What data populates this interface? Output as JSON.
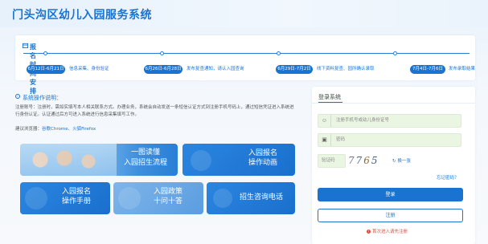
{
  "header": {
    "title": "门头沟区幼儿入园服务系统"
  },
  "schedule": {
    "title": "报名时间安排",
    "phases": [
      {
        "dates": "6月12日-6月21日",
        "desc": "信息采集、身份验证"
      },
      {
        "dates": "6月26日-6月28日",
        "desc": "发布复查通知，请认入园查询"
      },
      {
        "dates": "6月29日-7月2日",
        "desc": "线下资料复查、园所确认录取"
      },
      {
        "dates": "7月4日-7月6日",
        "desc": "发布录取结果"
      }
    ]
  },
  "operations": {
    "title": "系统操作说明：",
    "text": "注册账号：注册时，需如实填写本人相关联系方式。办理业务，系统会自动发送一条短信认证方式到注册手机号码上，通过短信凭证进入系统进行身份认证。认证通过后方可进入系统进行信息采集填写工作。",
    "browser_prefix": "建议浏览器：",
    "browser_links": "谷歌Chrome、火狐Firefox"
  },
  "tiles": {
    "t1_line1": "一图读懂",
    "t1_line2": "入园招生流程",
    "t2_line1": "入园报名",
    "t2_line2": "操作动画",
    "t3_line1": "入园报名",
    "t3_line2": "操作手册",
    "t4_line1": "入园政策",
    "t4_line2": "十问十答",
    "t5_line1": "招生咨询电话"
  },
  "login": {
    "title": "登录系统",
    "username_placeholder": "注册手机号或幼儿身份证号",
    "password_placeholder": "密码",
    "captcha_placeholder": "验证码",
    "captcha_digits": [
      "7",
      "7",
      "6",
      "5"
    ],
    "refresh_label": "换一张",
    "forgot_label": "忘记密码？",
    "login_button": "登录",
    "register_button": "注册",
    "first_note": "首次进入请先注册"
  },
  "colors": {
    "accent": "#1a73d0",
    "field_bg": "#eaf5e2",
    "warning": "#e04a3a"
  }
}
